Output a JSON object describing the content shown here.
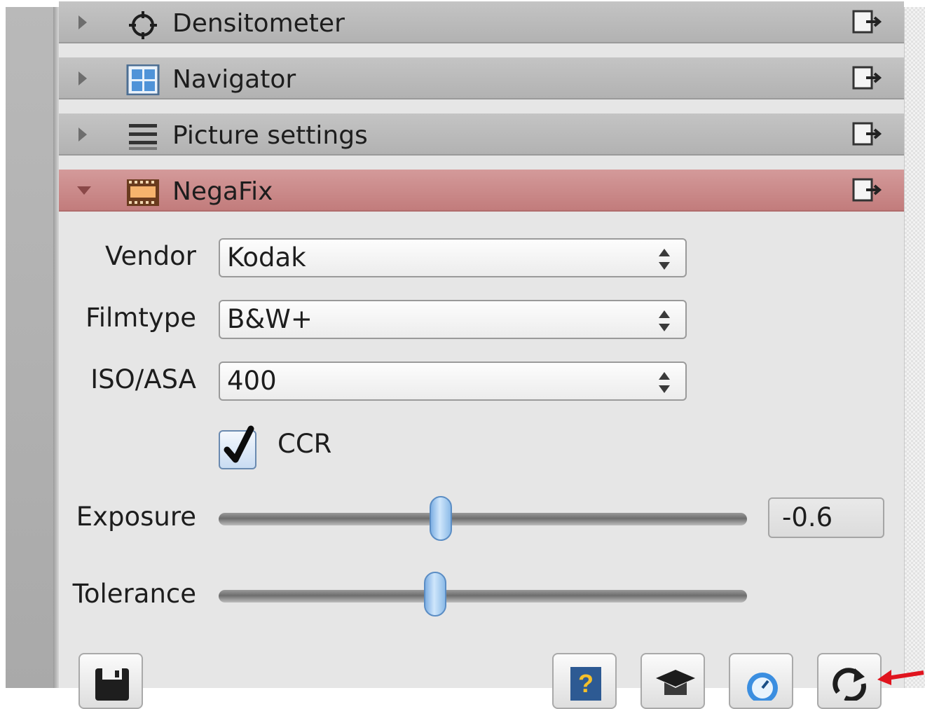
{
  "modules": [
    {
      "title": "Densitometer",
      "icon": "crosshair-icon",
      "expanded": false
    },
    {
      "title": "Navigator",
      "icon": "navigator-icon",
      "expanded": false
    },
    {
      "title": "Picture settings",
      "icon": "picture-settings-icon",
      "expanded": false
    },
    {
      "title": "NegaFix",
      "icon": "film-strip-icon",
      "expanded": true
    }
  ],
  "negafix": {
    "vendor_label": "Vendor",
    "vendor_value": "Kodak",
    "filmtype_label": "Filmtype",
    "filmtype_value": "B&W+",
    "iso_label": "ISO/ASA",
    "iso_value": "400",
    "ccr_label": "CCR",
    "ccr_checked": true,
    "exposure_label": "Exposure",
    "exposure_value": "-0.6",
    "exposure_level": 0.42,
    "tolerance_label": "Tolerance",
    "tolerance_level": 0.41
  },
  "bottom_buttons": [
    "save-icon",
    "help-icon",
    "graduation-cap-icon",
    "stopwatch-icon",
    "reset-icon"
  ],
  "colors": {
    "active_header": "#c98a8a",
    "header": "#bcbcbc",
    "panel": "#e6e6e6",
    "slider_handle": "#8cbbe8",
    "annotation_arrow": "#e0141e"
  }
}
